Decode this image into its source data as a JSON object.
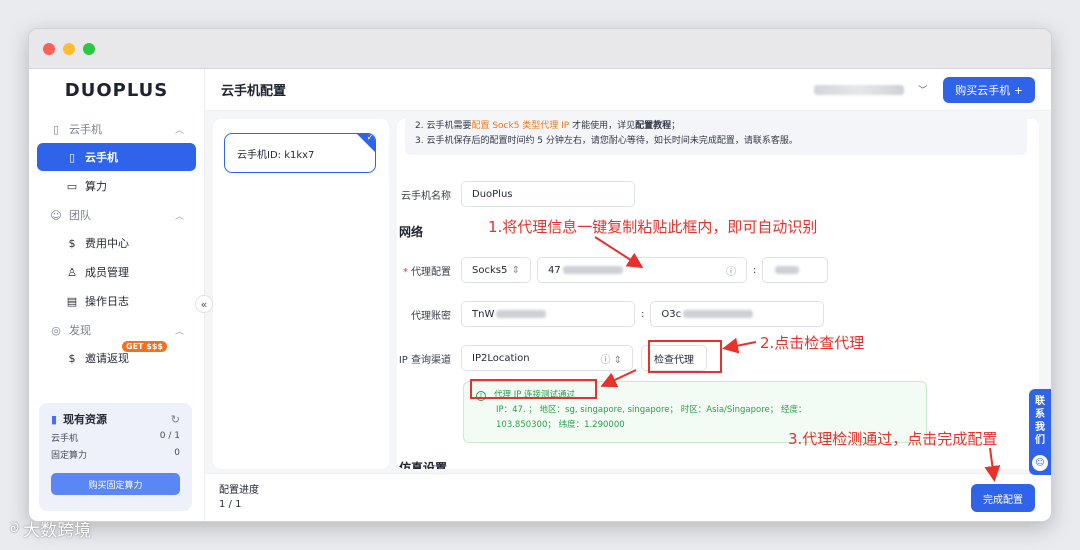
{
  "sidebar": {
    "logo": "DUOPLUS",
    "groups": [
      {
        "label": "云手机",
        "items": [
          {
            "label": "云手机",
            "active": true
          },
          {
            "label": "算力"
          }
        ]
      },
      {
        "label": "团队",
        "items": [
          {
            "label": "费用中心"
          },
          {
            "label": "成员管理"
          },
          {
            "label": "操作日志"
          }
        ]
      },
      {
        "label": "发现",
        "items": [
          {
            "label": "邀请返现",
            "badge": "GET $$$"
          }
        ]
      }
    ],
    "resources": {
      "title": "现有资源",
      "rows": [
        {
          "label": "云手机",
          "value": "0 / 1"
        },
        {
          "label": "固定算力",
          "value": "0"
        }
      ],
      "button": "购买固定算力"
    },
    "collapse_icon": "«"
  },
  "header": {
    "title": "云手机配置",
    "buy_button": "购买云手机 +"
  },
  "device": {
    "label": "云手机ID: k1kx7"
  },
  "notice": {
    "line1_a": "2. 云手机需要",
    "line1_hl": "配置 Sock5 类型代理 IP",
    "line1_b": " 才能使用，详见",
    "line1_bold": "配置教程",
    "line1_c": "；",
    "line2": "3. 云手机保存后的配置时间约 5 分钟左右，请您耐心等待，如长时间未完成配置，请联系客服。"
  },
  "form": {
    "name_label": "云手机名称",
    "name_value": "DuoPlus",
    "section_network": "网络",
    "proxy_label": "代理配置",
    "proxy_type": "Socks5",
    "proxy_host_prefix": "47",
    "proxy_sep": ":",
    "account_label": "代理账密",
    "account_user_prefix": "TnW",
    "account_pass_prefix": "O3c",
    "ipq_label": "IP 查询渠道",
    "ipq_value": "IP2Location",
    "check_button": "检查代理",
    "section_sim": "仿真设置"
  },
  "result": {
    "title": "代理 IP 连接测试通过",
    "detail_line1": "IP：47.          ；  地区：sg, singapore, singapore；  时区：Asia/Singapore；  经度：",
    "detail_line2": "103.850300；  纬度：1.290000"
  },
  "footer": {
    "progress_label": "配置进度",
    "progress_value": "1 / 1",
    "finish_button": "完成配置"
  },
  "contact": {
    "chars": [
      "联",
      "系",
      "我",
      "们"
    ]
  },
  "annotations": {
    "step1": "1.将代理信息一键复制粘贴此框内，即可自动识别",
    "step2": "2.点击检查代理",
    "step3": "3.代理检测通过，点击完成配置",
    "color": "#e8312a"
  },
  "watermark": "大数跨境",
  "colors": {
    "accent": "#2f63ea",
    "success": "#2aa14a",
    "warning": "#f07a1c"
  }
}
